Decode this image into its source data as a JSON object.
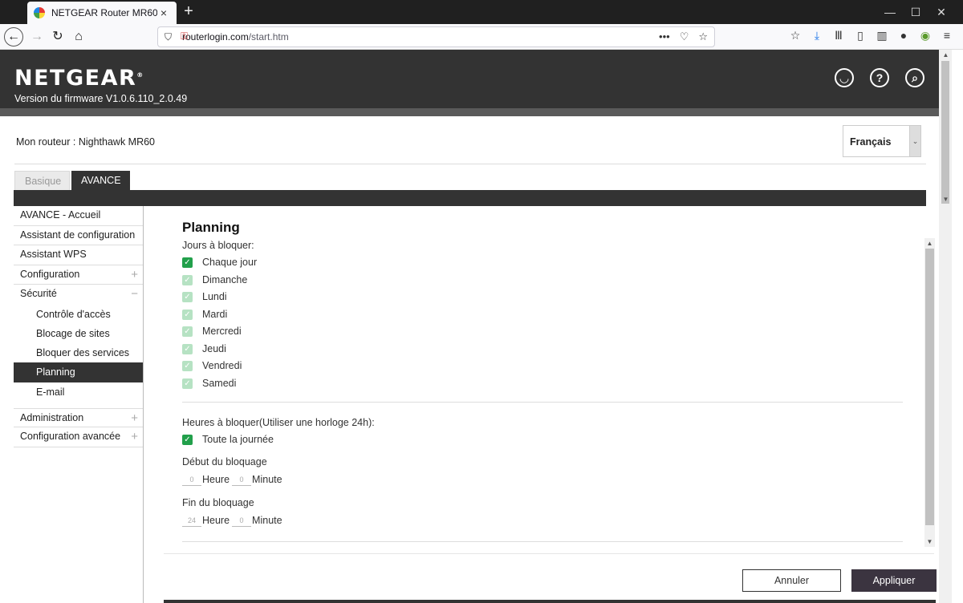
{
  "browser": {
    "tab_title": "NETGEAR Router MR60",
    "url_host": "routerlogin.com",
    "url_path": "/start.htm",
    "window_controls": {
      "minimize": "—",
      "maximize": "☐",
      "close": "✕"
    }
  },
  "header": {
    "logo": "NETGEAR",
    "firmware": "Version du firmware V1.0.6.110_2.0.49"
  },
  "router": {
    "label": "Mon routeur :",
    "model": "Nighthawk MR60",
    "language": "Français"
  },
  "tabs": {
    "basic": "Basique",
    "advanced": "AVANCE"
  },
  "sidebar": {
    "items": [
      {
        "label": "AVANCE - Accueil"
      },
      {
        "label": "Assistant de configuration"
      },
      {
        "label": "Assistant WPS"
      },
      {
        "label": "Configuration",
        "toggle": "+"
      },
      {
        "label": "Sécurité",
        "toggle": "−"
      }
    ],
    "security_sub": [
      {
        "label": "Contrôle d'accès"
      },
      {
        "label": "Blocage de sites"
      },
      {
        "label": "Bloquer des services"
      },
      {
        "label": "Planning"
      },
      {
        "label": "E-mail"
      }
    ],
    "bottom_items": [
      {
        "label": "Administration",
        "toggle": "+"
      },
      {
        "label": "Configuration avancée",
        "toggle": "+"
      }
    ]
  },
  "planning": {
    "title": "Planning",
    "days_label": "Jours à bloquer:",
    "days": [
      {
        "label": "Chaque jour",
        "checked": true
      },
      {
        "label": "Dimanche",
        "checked": true
      },
      {
        "label": "Lundi",
        "checked": true
      },
      {
        "label": "Mardi",
        "checked": true
      },
      {
        "label": "Mercredi",
        "checked": true
      },
      {
        "label": "Jeudi",
        "checked": true
      },
      {
        "label": "Vendredi",
        "checked": true
      },
      {
        "label": "Samedi",
        "checked": true
      }
    ],
    "hours_label": "Heures à bloquer(Utiliser une horloge 24h):",
    "all_day": "Toute la journée",
    "start_label": "Début du bloquage",
    "start_hour": "0",
    "start_minute": "0",
    "end_label": "Fin du bloquage",
    "end_hour": "24",
    "end_minute": "0",
    "hour_unit": "Heure",
    "minute_unit": "Minute"
  },
  "actions": {
    "cancel": "Annuler",
    "apply": "Appliquer"
  },
  "colors": {
    "header_bg": "#333333",
    "checkbox_green": "#22a04b",
    "apply_bg": "#3b3440"
  }
}
